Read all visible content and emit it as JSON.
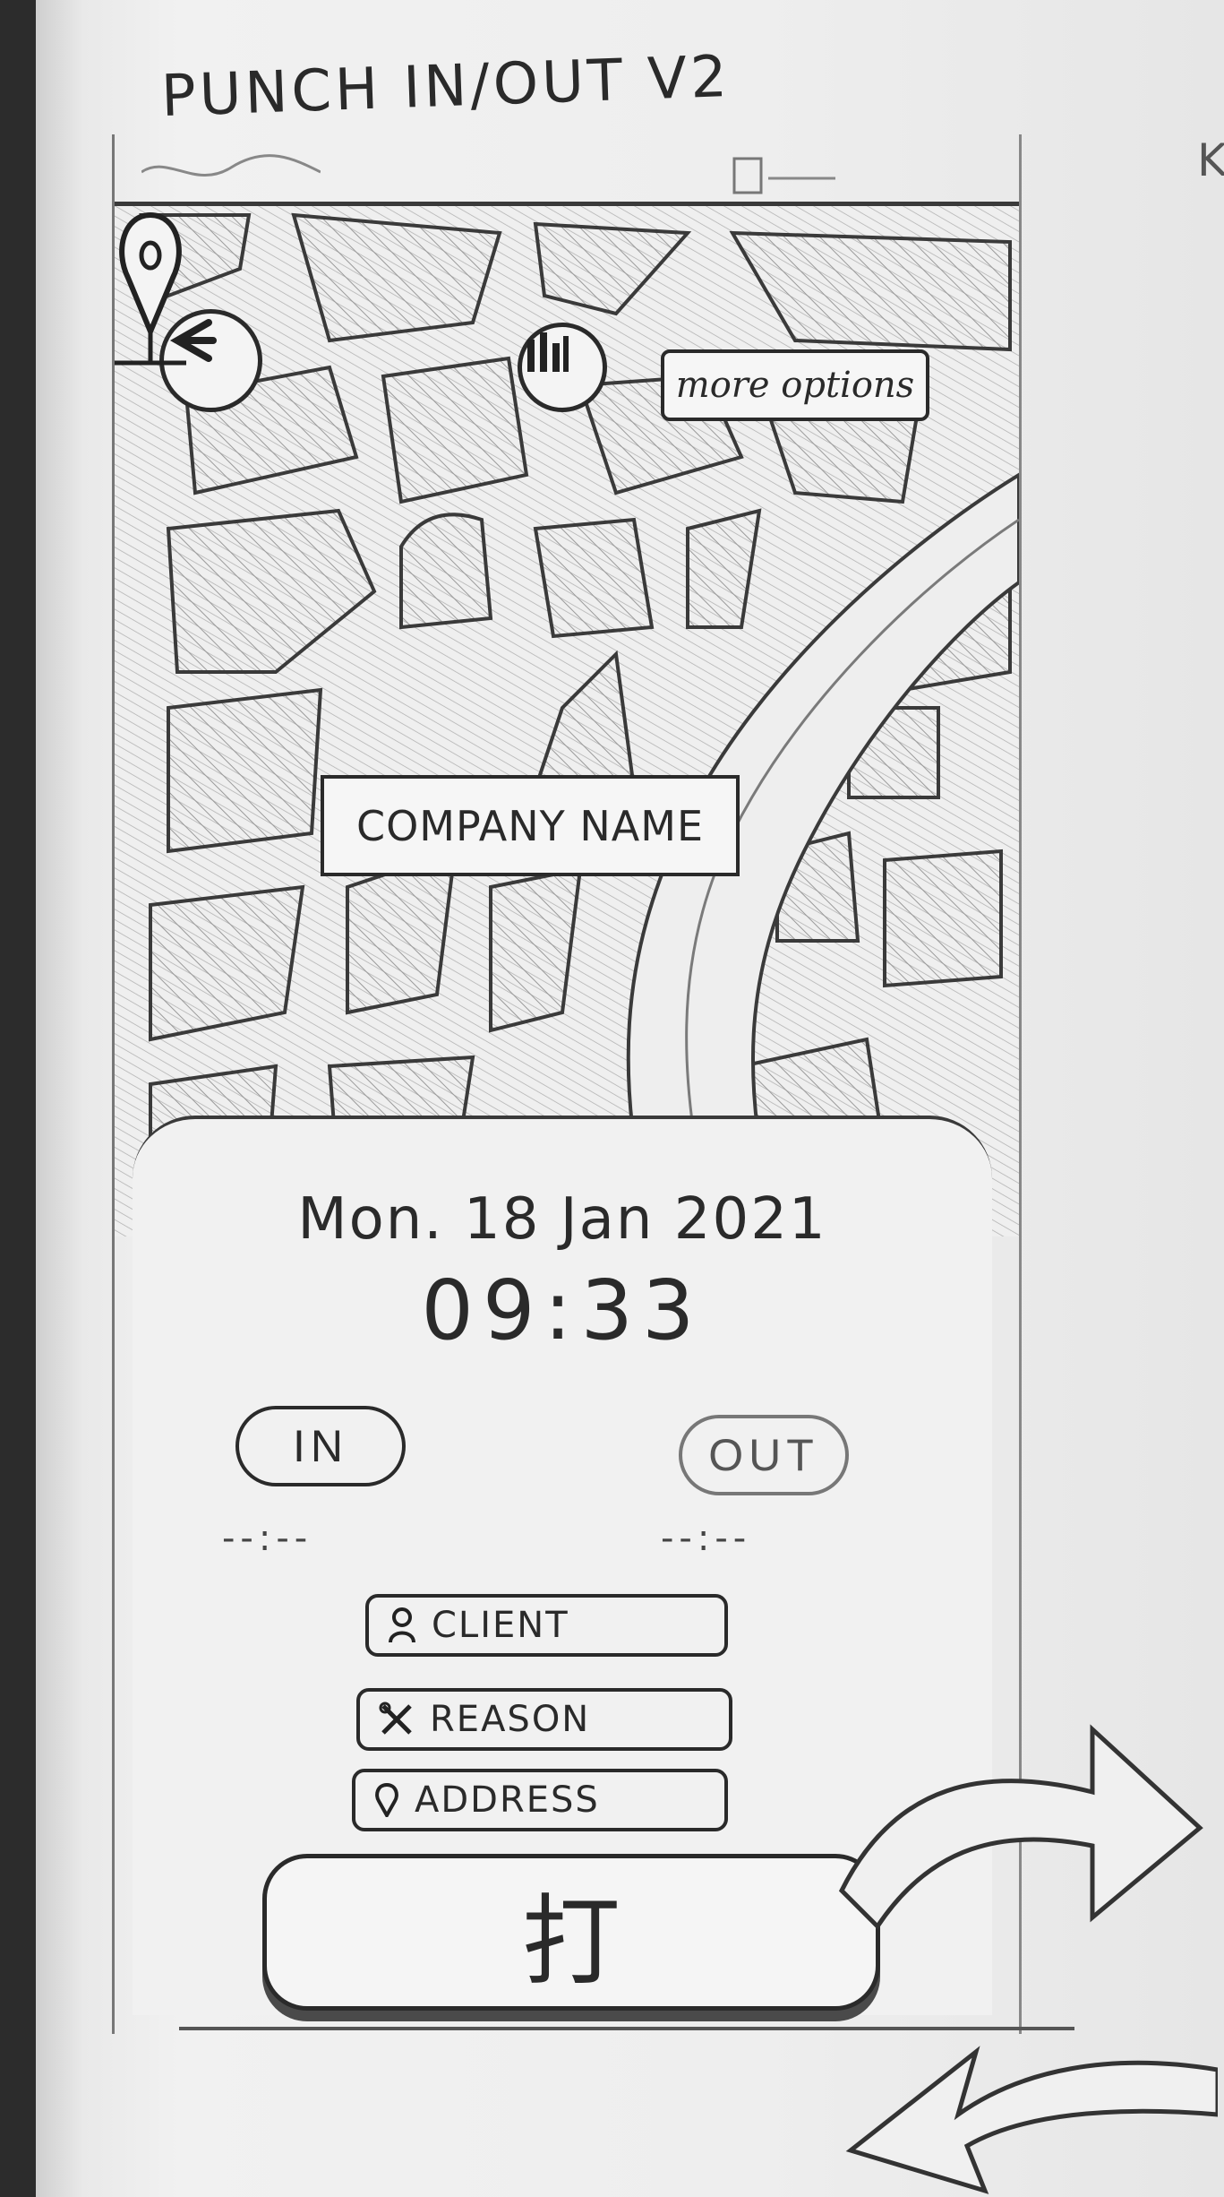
{
  "sketch": {
    "title": "PUNCH IN/OUT V2",
    "edge_mark": "K"
  },
  "header": {
    "back_icon": "arrow-left-icon",
    "stats_icon": "bar-chart-icon",
    "more_options_label": "more options"
  },
  "map": {
    "pin_icon": "location-pin-icon",
    "company_label": "COMPANY NAME"
  },
  "sheet": {
    "date": "Mon. 18 Jan 2021",
    "time": "09:33",
    "in_label": "IN",
    "out_label": "OUT",
    "in_time": "--:--",
    "out_time": "--:--",
    "fields": [
      {
        "icon": "person-icon",
        "label": "CLIENT"
      },
      {
        "icon": "tools-icon",
        "label": "REASON"
      },
      {
        "icon": "pin-icon",
        "label": "ADDRESS"
      }
    ],
    "punch_label": "打"
  }
}
